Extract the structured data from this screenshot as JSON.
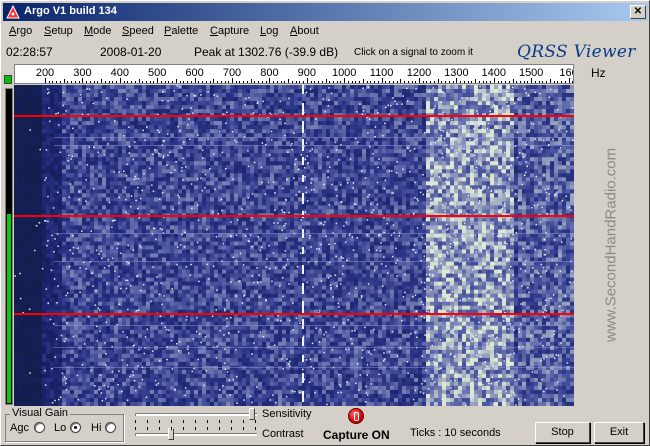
{
  "window": {
    "title": "Argo V1 build 134",
    "close_glyph": "✕"
  },
  "menu": [
    {
      "label": "Argo",
      "key": "A",
      "rest": "rgo"
    },
    {
      "label": "Setup",
      "key": "S",
      "rest": "etup"
    },
    {
      "label": "Mode",
      "key": "M",
      "rest": "ode"
    },
    {
      "label": "Speed",
      "key": "S",
      "rest": "peed"
    },
    {
      "label": "Palette",
      "key": "P",
      "rest": "alette"
    },
    {
      "label": "Capture",
      "key": "C",
      "rest": "apture"
    },
    {
      "label": "Log",
      "key": "L",
      "rest": "og"
    },
    {
      "label": "About",
      "key": "A",
      "rest": "bout"
    }
  ],
  "status": {
    "time": "02:28:57",
    "date": "2008-01-20",
    "peak": "Peak at 1302.76 (-39.9 dB)",
    "hint": "Click on a signal to zoom it",
    "brand": "QRSS Viewer"
  },
  "scale": {
    "unit": "Hz",
    "labels": [
      "200",
      "300",
      "400",
      "500",
      "600",
      "700",
      "800",
      "900",
      "1000",
      "1100",
      "1200",
      "1300",
      "1400",
      "1500",
      "160"
    ]
  },
  "watermark": "www.SecondHandRadio.com",
  "gain": {
    "legend": "Visual Gain",
    "options": [
      "Agc",
      "Lo",
      "Hi"
    ],
    "selected": "Lo"
  },
  "sliders": {
    "sensitivity_label": "Sensitivity",
    "contrast_label": "Contrast",
    "sensitivity_value": 1.0,
    "contrast_value": 0.3
  },
  "capture": {
    "status": "Capture ON"
  },
  "ticks": "Ticks  : 10 seconds",
  "buttons": {
    "stop": "Stop",
    "exit": "Exit"
  },
  "colors": {
    "titlebar_start": "#0a246a",
    "marker_lines": "#ff0000",
    "spectrogram_base": "#0a0a30",
    "noise": "#3c46b4",
    "brand_text": "#0a3a8a",
    "capture_led": "#e00000"
  }
}
